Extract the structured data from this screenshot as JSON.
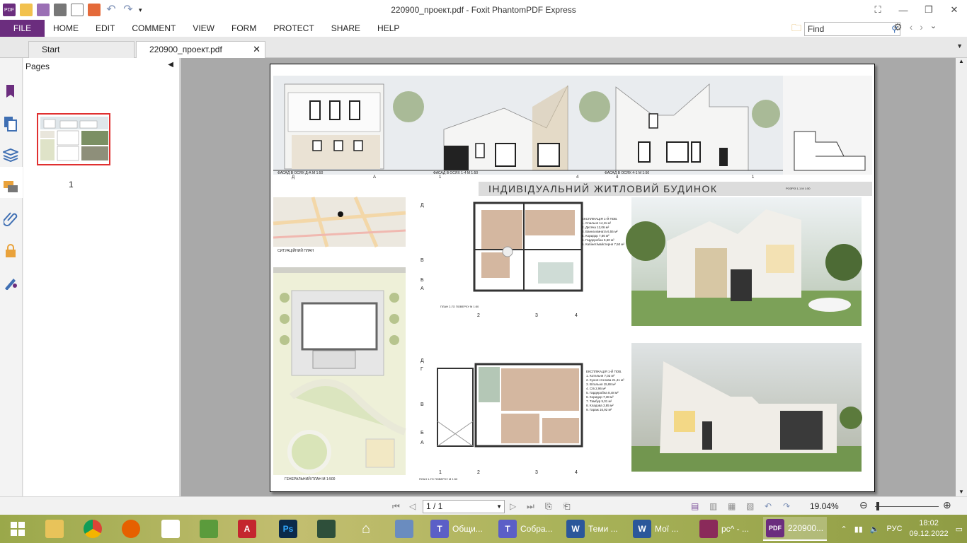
{
  "window": {
    "title": "220900_проект.pdf - Foxit PhantomPDF Express",
    "controls": [
      "restore-icon",
      "minimize-icon",
      "maximize-icon",
      "close-icon"
    ]
  },
  "menu": {
    "file": "FILE",
    "items": [
      "HOME",
      "EDIT",
      "COMMENT",
      "VIEW",
      "FORM",
      "PROTECT",
      "SHARE",
      "HELP"
    ]
  },
  "find": {
    "placeholder": "Find"
  },
  "tabs": [
    {
      "label": "Start"
    },
    {
      "label": "220900_проект.pdf"
    }
  ],
  "pages_panel": {
    "title": "Pages",
    "thumb_number": "1"
  },
  "document": {
    "heading": "ІНДИВІДУАЛЬНИЙ ЖИТЛОВИЙ БУДИНОК",
    "facades": [
      {
        "caption": "ФАСАД В ОСЯХ Д-А  М 1:50",
        "axes": [
          "Д",
          "А"
        ]
      },
      {
        "caption": "ФАСАД В ОСЯХ 1-4 М 1:50",
        "axes": [
          "1",
          "4"
        ]
      },
      {
        "caption": "ФАСАД В ОСЯХ 4-1  М 1:50",
        "axes": [
          "4",
          "1"
        ]
      }
    ],
    "section_caption": "РОЗРІЗ 1-1  М 1:50",
    "situation_caption": "СИТУАЦІЙНИЙ ПЛАН",
    "general_plan_caption": "ГЕНЕРАЛЬНИЙ ПЛАН  М 1:500",
    "plan2_caption": "ПЛАН 2-ГО ПОВЕРХУ М 1:50",
    "plan1_caption": "ПЛАН 1-ГО ПОВЕРХУ М 1:50",
    "explication2": {
      "title": "ЕКСПЛІКАЦІЯ 1-Й ПОВ.",
      "rows": [
        "1. Спальня        14,11 м²",
        "2. Дитяча         12,06 м²",
        "3. Ванна кімната   6,55 м²",
        "4. Коридор         7,66 м²",
        "5. Гардеробна      5,60 м²",
        "6. Кабінет/майстерня 7,50 м²"
      ]
    },
    "explication1": {
      "title": "ЕКСПЛІКАЦІЯ 1-Й ПОВ.",
      "rows": [
        "1. Котельня        7,02 м²",
        "2. Кухня-столова  21,41 м²",
        "3. Вітальня       15,88 м²",
        "4. С/в             2,96 м²",
        "5. Гардеробна      8,48 м²",
        "6. Коридор         7,38 м²",
        "7. Тамбур          5,01 м²",
        "8. Кладова         3,85 м²",
        "9. Гараж          16,92 м²"
      ]
    },
    "grid_rows": [
      "Д",
      "Г",
      "В",
      "Б",
      "А"
    ],
    "grid_cols": [
      "1",
      "2",
      "3",
      "4"
    ]
  },
  "statusbar": {
    "page_nav": "1 / 1",
    "zoom": "19.04%"
  },
  "taskbar": {
    "apps": [
      {
        "label": "Общи...",
        "icon": "teams-icon",
        "color": "#5b5fc7"
      },
      {
        "label": "Собра...",
        "icon": "teams-icon",
        "color": "#5b5fc7"
      },
      {
        "label": "Теми ...",
        "icon": "word-icon",
        "color": "#2b579a"
      },
      {
        "label": "Мої ...",
        "icon": "word-icon",
        "color": "#2b579a"
      },
      {
        "label": "рс^ - ...",
        "icon": "floppy-icon",
        "color": "#8a2a5a"
      },
      {
        "label": "220900...",
        "icon": "foxit-pdf-icon",
        "color": "#6b2d7e"
      }
    ],
    "lang": "РУС",
    "time": "18:02",
    "date": "09.12.2022"
  }
}
